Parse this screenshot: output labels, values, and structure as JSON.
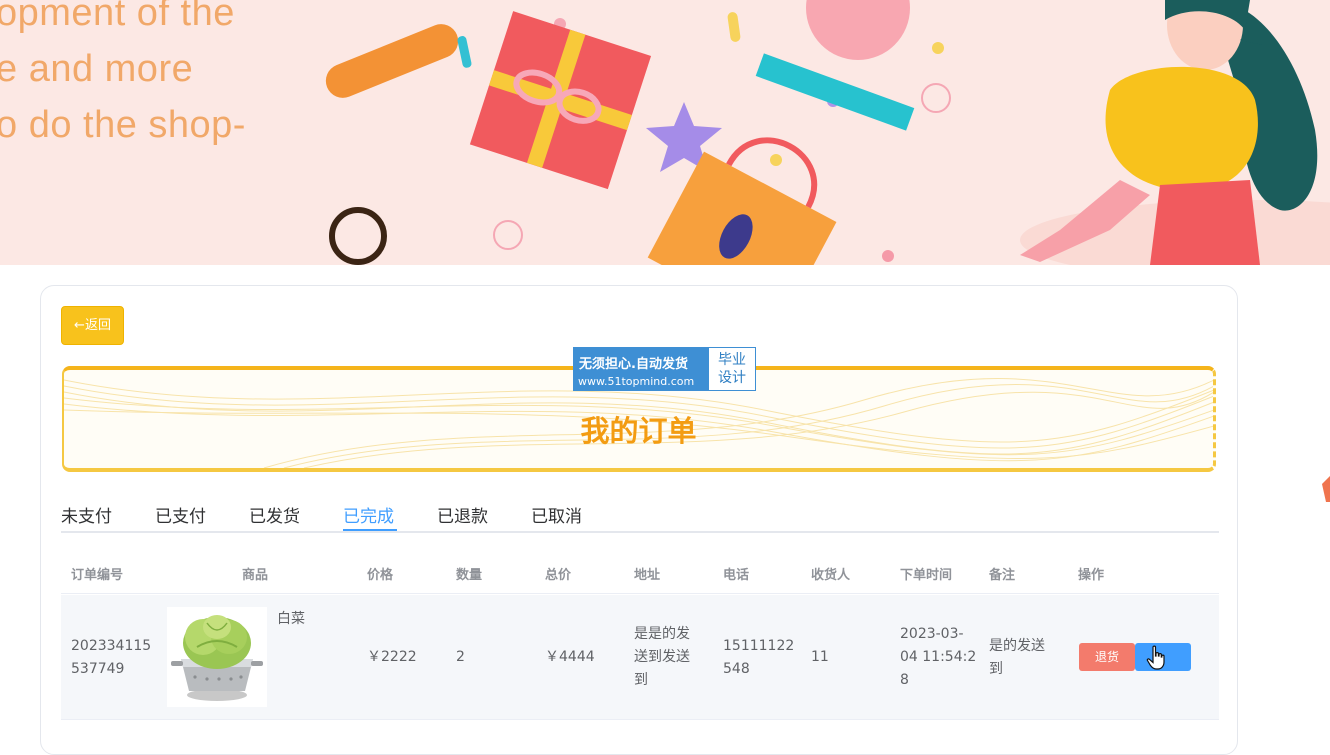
{
  "banner": {
    "lines": [
      "opment of the",
      "e and more",
      "o do the shop-"
    ]
  },
  "back_button": {
    "label": "←返回"
  },
  "watermark": {
    "line1": "无须担心.自动发货",
    "line2": "www.51topmind.com",
    "right_line1": "毕业",
    "right_line2": "设计"
  },
  "page_title": "我的订单",
  "tabs": [
    {
      "label": "未支付"
    },
    {
      "label": "已支付"
    },
    {
      "label": "已发货"
    },
    {
      "label": "已完成",
      "active": true
    },
    {
      "label": "已退款"
    },
    {
      "label": "已取消"
    }
  ],
  "table": {
    "headers": [
      "订单编号",
      "商品",
      "价格",
      "数量",
      "总价",
      "地址",
      "电话",
      "收货人",
      "下单时间",
      "备注",
      "操作"
    ],
    "rows": [
      {
        "order_no_line1": "202334115",
        "order_no_line2": "537749",
        "goods_name": "白菜",
        "goods_icon": "cabbage-in-colander-image",
        "price": "￥2222",
        "quantity": "2",
        "total": "￥4444",
        "address_line1": "是是的发",
        "address_line2": "送到发送",
        "address_line3": "到",
        "phone_line1": "15111122",
        "phone_line2": "548",
        "receiver": "11",
        "time_line1": "2023-03-",
        "time_line2": "04 11:54:2",
        "time_line3": "8",
        "remark_line1": "是的发送",
        "remark_line2": "到",
        "refund_label": "退货"
      }
    ]
  },
  "colors": {
    "accent": "#409eff",
    "back_button": "#f8c21c",
    "title": "#f39c12",
    "refund": "#f37b6c",
    "watermark": "#3e8fd4"
  }
}
